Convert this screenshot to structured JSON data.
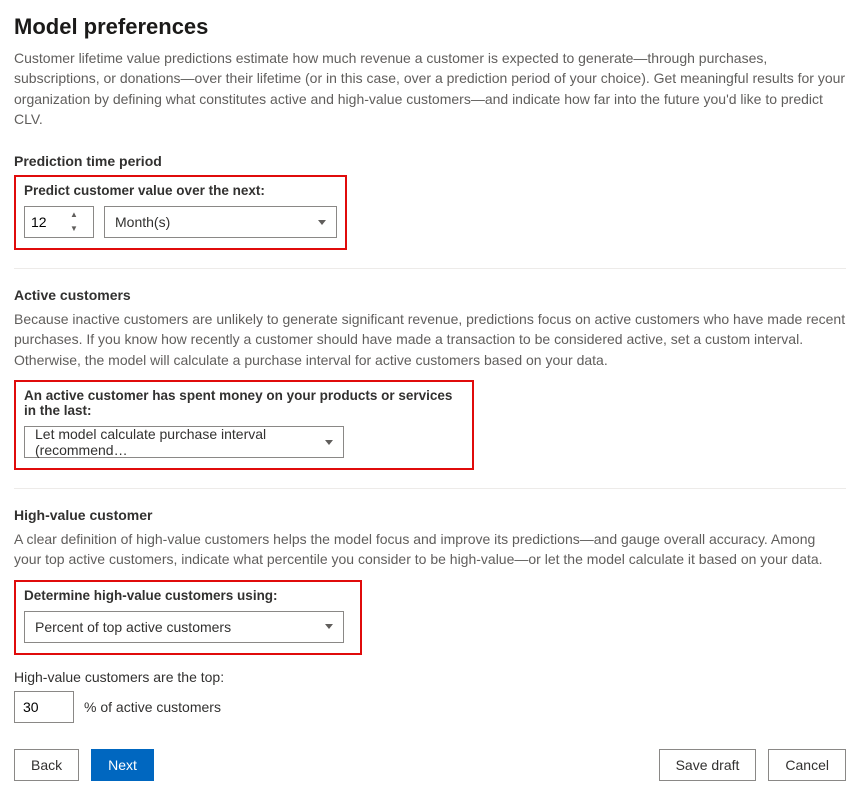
{
  "header": {
    "title": "Model preferences",
    "intro": "Customer lifetime value predictions estimate how much revenue a customer is expected to generate—through purchases, subscriptions, or donations—over their lifetime (or in this case, over a prediction period of your choice). Get meaningful results for your organization by defining what constitutes active and high-value customers—and indicate how far into the future you'd like to predict CLV."
  },
  "prediction": {
    "section_title": "Prediction time period",
    "label": "Predict customer value over the next:",
    "value": "12",
    "unit_selected": "Month(s)"
  },
  "active": {
    "section_title": "Active customers",
    "desc": "Because inactive customers are unlikely to generate significant revenue, predictions focus on active customers who have made recent purchases. If you know how recently a customer should have made a transaction to be considered active, set a custom interval. Otherwise, the model will calculate a purchase interval for active customers based on your data.",
    "label": "An active customer has spent money on your products or services in the last:",
    "selected": "Let model calculate purchase interval (recommend…"
  },
  "highvalue": {
    "section_title": "High-value customer",
    "desc": "A clear definition of high-value customers helps the model focus and improve its predictions—and gauge overall accuracy. Among your top active customers, indicate what percentile you consider to be high-value—or let the model calculate it based on your data.",
    "label": "Determine high-value customers using:",
    "selected": "Percent of top active customers",
    "top_label": "High-value customers are the top:",
    "top_value": "30",
    "top_suffix": "%  of active customers"
  },
  "footer": {
    "back": "Back",
    "next": "Next",
    "save_draft": "Save draft",
    "cancel": "Cancel"
  }
}
